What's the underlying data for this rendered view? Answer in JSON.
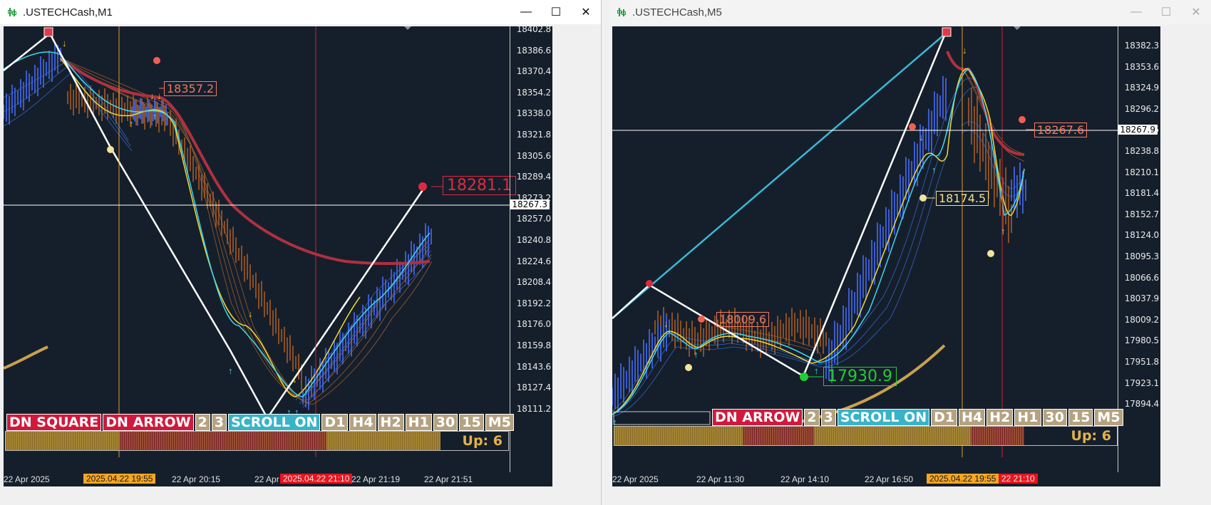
{
  "windows": [
    {
      "title": ".USTECHCash,M1",
      "controls": {
        "minimize": "—",
        "maximize": "☐",
        "close": "✕"
      },
      "price_ticks": [
        "18402.8",
        "18386.6",
        "18370.4",
        "18354.2",
        "18338.0",
        "18321.8",
        "18305.6",
        "18289.4",
        "18273.2",
        "18257.0",
        "18240.8",
        "18224.6",
        "18208.4",
        "18192.2",
        "18176.0",
        "18159.8",
        "18143.6",
        "18127.4",
        "18111.2"
      ],
      "current_price": "18267.3",
      "labels": {
        "peak": "18357.2",
        "big": "18281.1"
      },
      "time_labels": [
        "22 Apr 2025",
        "22 Apr 20:15",
        "22 Apr",
        "22 Apr 21:19",
        "22 Apr 21:51"
      ],
      "time_tags": [
        {
          "text": "2025.04.22 19:55",
          "color": "#f5a623"
        },
        {
          "text": "2025.04.22 21:10",
          "color": "#e8141e"
        }
      ],
      "buttons": [
        {
          "label": "DN SQUARE",
          "style": "red"
        },
        {
          "label": "DN ARROW",
          "style": "red"
        },
        {
          "label": "2",
          "style": "tan"
        },
        {
          "label": "3",
          "style": "tan"
        },
        {
          "label": "SCROLL ON",
          "style": "teal"
        },
        {
          "label": "D1",
          "style": "tan"
        },
        {
          "label": "H4",
          "style": "tan"
        },
        {
          "label": "H2",
          "style": "tan"
        },
        {
          "label": "H1",
          "style": "tan"
        },
        {
          "label": "30",
          "style": "tan"
        },
        {
          "label": "15",
          "style": "tan"
        },
        {
          "label": "M5",
          "style": "tan"
        }
      ],
      "status": "Up: 6"
    },
    {
      "title": ".USTECHCash,M5",
      "controls": {
        "minimize": "—",
        "maximize": "☐",
        "close": "✕"
      },
      "price_ticks": [
        "18382.3",
        "18353.6",
        "18324.9",
        "18296.2",
        "18267.5",
        "18238.8",
        "18210.1",
        "18181.4",
        "18152.7",
        "18124.0",
        "18095.3",
        "18066.6",
        "18037.9",
        "18009.2",
        "17980.5",
        "17951.8",
        "17923.1",
        "17894.4"
      ],
      "current_price": "18267.9",
      "labels": {
        "high": "18267.6",
        "mid": "18174.5",
        "low1": "18009.6",
        "big": "17930.9"
      },
      "time_labels": [
        "22 Apr 2025",
        "22 Apr 11:30",
        "22 Apr 14:10",
        "22 Apr 16:50"
      ],
      "time_tags": [
        {
          "text": "2025.04.22 19:55",
          "color": "#f5a623"
        },
        {
          "text": "22 21:10",
          "color": "#e8141e"
        }
      ],
      "buttons": [
        {
          "label": "DN ARROW",
          "style": "red"
        },
        {
          "label": "2",
          "style": "tan"
        },
        {
          "label": "3",
          "style": "tan"
        },
        {
          "label": "SCROLL ON",
          "style": "teal"
        },
        {
          "label": "D1",
          "style": "tan"
        },
        {
          "label": "H4",
          "style": "tan"
        },
        {
          "label": "H2",
          "style": "tan"
        },
        {
          "label": "H1",
          "style": "tan"
        },
        {
          "label": "30",
          "style": "tan"
        },
        {
          "label": "15",
          "style": "tan"
        },
        {
          "label": "M5",
          "style": "tan"
        }
      ],
      "status": "Up: 6"
    }
  ],
  "colors": {
    "chart_bg": "#151f2b",
    "red_label": "#e0293f",
    "orange_label": "#f07860",
    "green_label": "#22cc33",
    "yellow_label": "#f2e08a"
  }
}
